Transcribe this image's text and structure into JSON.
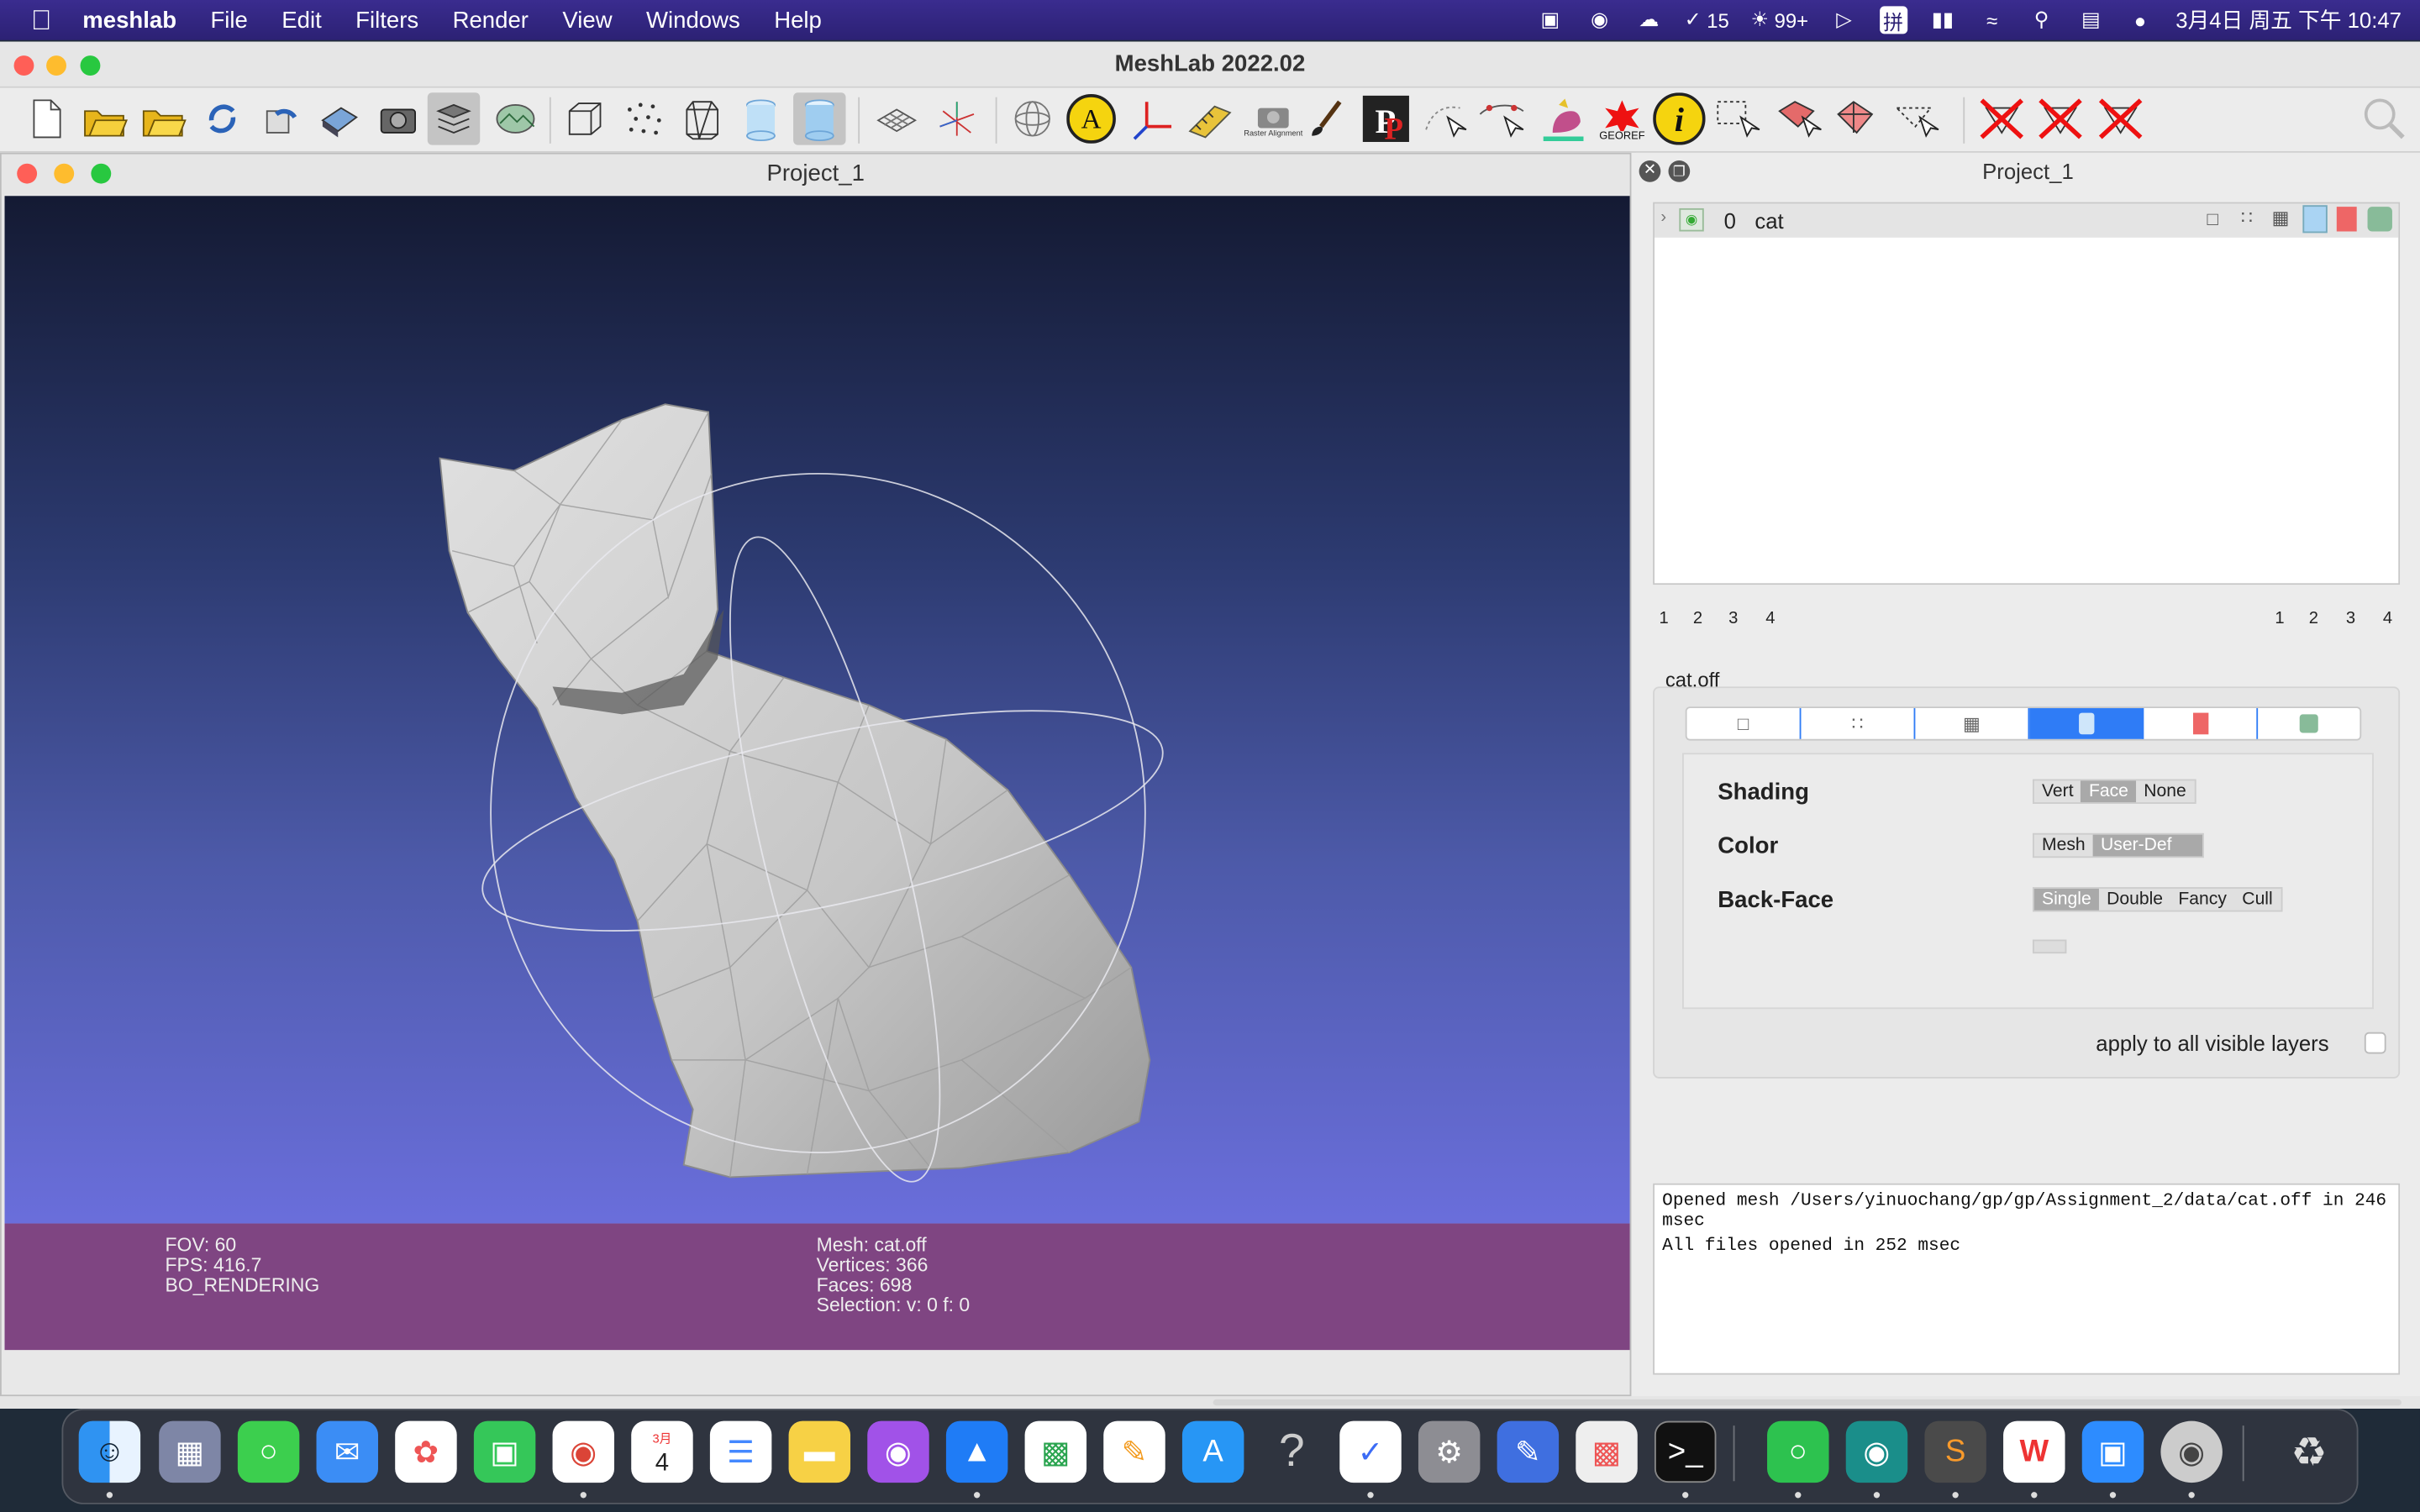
{
  "menubar": {
    "apple_icon": "apple-logo",
    "app_name": "meshlab",
    "menus": [
      "File",
      "Edit",
      "Filters",
      "Render",
      "View",
      "Windows",
      "Help"
    ],
    "status_items": {
      "reminders_count": "15",
      "wechat_count": "99+",
      "input_method": "拼",
      "datetime": "3月4日 周五 下午 10:47"
    }
  },
  "window": {
    "title": "MeshLab 2022.02"
  },
  "toolbar": {
    "icons": [
      "new-project-icon",
      "open-icon",
      "open-folder-icon",
      "reload-icon",
      "reload-all-icon",
      "save-icon",
      "snapshot-icon",
      "layers-icon",
      "raster-icon",
      "bbox-icon",
      "points-icon",
      "wireframe-icon",
      "flat-icon",
      "smooth-icon",
      "grid-icon",
      "axis-icon",
      "sphere-icon",
      "annotate-icon",
      "align-icon",
      "measure-icon",
      "raster-alignment-icon",
      "paint-icon",
      "pickpoints-icon",
      "manipulator-icon",
      "edit-icon",
      "colorize-icon",
      "georef-icon",
      "info-icon",
      "select-rect-icon",
      "select-faces-icon",
      "select-vertices-icon",
      "select-cursor-icon",
      "delete-icon",
      "delete-faces-icon",
      "delete-vertices-icon",
      "search-icon"
    ],
    "raster_alignment_label": "Raster Alignment",
    "georef_label": "GEOREF"
  },
  "project": {
    "title": "Project_1",
    "info_left": {
      "fov": "FOV: 60",
      "fps": "FPS:   416.7",
      "mode": "BO_RENDERING"
    },
    "info_right": {
      "mesh": "Mesh: cat.off",
      "vertices": "Vertices: 366",
      "faces": "Faces: 698",
      "selection": "Selection: v: 0 f: 0"
    }
  },
  "layers": {
    "title": "Project_1",
    "rows": [
      {
        "index": "0",
        "name": "cat"
      }
    ],
    "pages_left": [
      "1",
      "2",
      "3",
      "4"
    ],
    "pages_right": [
      "1",
      "2",
      "3",
      "4"
    ],
    "selected_file": "cat.off"
  },
  "render": {
    "modes": [
      "bbox",
      "points",
      "wireframe",
      "solid",
      "texture",
      "lighting"
    ],
    "selected_mode": "solid",
    "shading_label": "Shading",
    "shading_options": [
      "Vert",
      "Face",
      "None"
    ],
    "shading_selected": "Face",
    "color_label": "Color",
    "color_options": [
      "Mesh",
      "User-Def"
    ],
    "color_selected": "User-Def",
    "backface_label": "Back-Face",
    "backface_options": [
      "Single",
      "Double",
      "Fancy",
      "Cull"
    ],
    "backface_selected": "Single",
    "apply_all_label": "apply to all visible layers"
  },
  "log": {
    "line1": "Opened mesh /Users/yinuochang/gp/gp/Assignment_2/data/cat.off in 246",
    "line1b": "msec",
    "line2": "All files opened in 252 msec"
  },
  "dock": {
    "apps": [
      "finder",
      "launchpad",
      "messages",
      "mail",
      "photos",
      "facetime",
      "chrome",
      "calendar",
      "reminders",
      "notes",
      "podcasts",
      "keynote",
      "numbers",
      "pages",
      "app-store",
      "help",
      "tasks",
      "settings",
      "paint",
      "grid-app",
      "terminal",
      "wechat",
      "network-app",
      "sublime",
      "wps",
      "zoom",
      "eye-app",
      "trash"
    ],
    "calendar_month": "3月",
    "calendar_day": "4"
  },
  "colors": {
    "menubar": "#2c2174",
    "info_bar": "#7f4582",
    "accent": "#2f7cf6"
  }
}
